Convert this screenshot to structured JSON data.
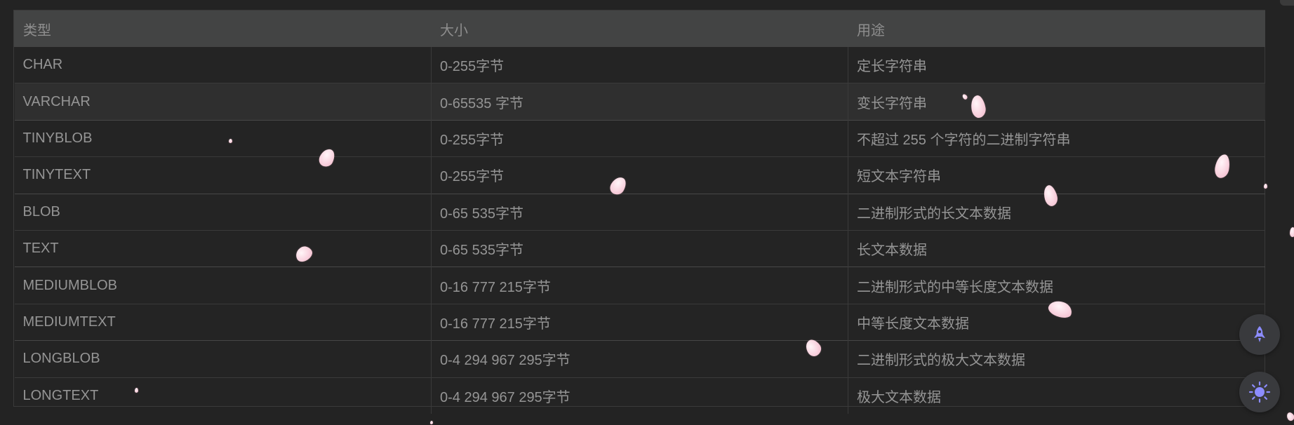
{
  "table": {
    "headers": [
      "类型",
      "大小",
      "用途"
    ],
    "rows": [
      [
        "CHAR",
        "0-255字节",
        "定长字符串"
      ],
      [
        "VARCHAR",
        "0-65535 字节",
        "变长字符串"
      ],
      [
        "TINYBLOB",
        "0-255字节",
        "不超过 255 个字符的二进制字符串"
      ],
      [
        "TINYTEXT",
        "0-255字节",
        "短文本字符串"
      ],
      [
        "BLOB",
        "0-65 535字节",
        "二进制形式的长文本数据"
      ],
      [
        "TEXT",
        "0-65 535字节",
        "长文本数据"
      ],
      [
        "MEDIUMBLOB",
        "0-16 777 215字节",
        "二进制形式的中等长度文本数据"
      ],
      [
        "MEDIUMTEXT",
        "0-16 777 215字节",
        "中等长度文本数据"
      ],
      [
        "LONGBLOB",
        "0-4 294 967 295字节",
        "二进制形式的极大文本数据"
      ],
      [
        "LONGTEXT",
        "0-4 294 967 295字节",
        "极大文本数据"
      ]
    ],
    "highlighted_row": 1
  },
  "floating_buttons": [
    {
      "icon": "rocket-icon",
      "color": "#8c8cff"
    },
    {
      "icon": "sun-icon",
      "color": "#8c8cff"
    }
  ],
  "decorations": {
    "petal_color": "#f7c9d6"
  }
}
